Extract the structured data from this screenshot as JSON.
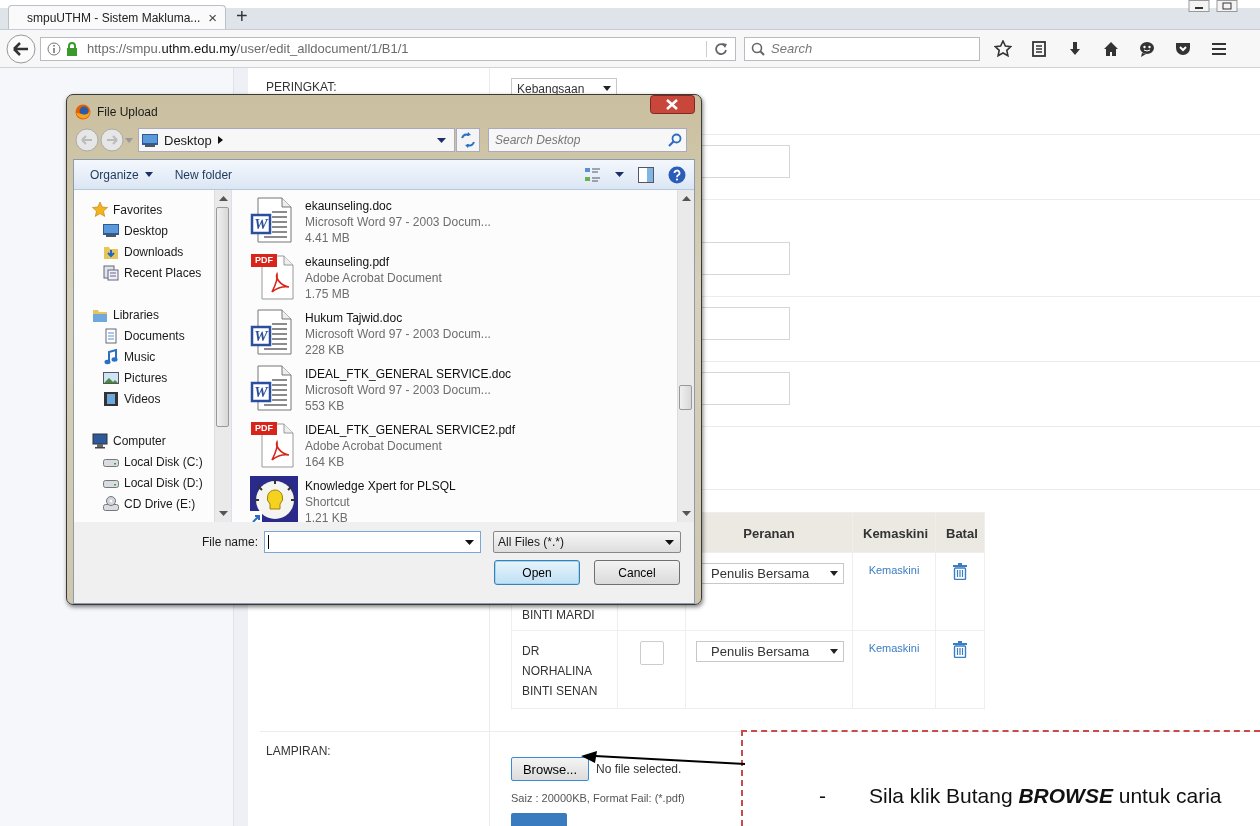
{
  "browser": {
    "tab": {
      "title": "smpuUTHM - Sistem Makluma...",
      "close": "×"
    },
    "new_tab": "+",
    "url": {
      "scheme": "https://smpu.",
      "host": "uthm.edu.my",
      "path": "/user/edit_alldocument/1/B1/1"
    },
    "search": {
      "placeholder": "Search"
    }
  },
  "form": {
    "rows": [
      {
        "kind": "select",
        "label": "PERINGKAT:",
        "value": "Kebangsaan"
      },
      {
        "kind": "input"
      },
      {
        "kind": "input"
      },
      {
        "kind": "input"
      },
      {
        "kind": "input"
      }
    ]
  },
  "authors_table": {
    "columns": [
      "Peranan",
      "Kemaskini",
      "Batal"
    ],
    "rows": [
      {
        "name": "BINTI MARDI",
        "role": "Penulis Bersama",
        "action": "Kemaskini"
      },
      {
        "name": "DR NORHALINA BINTI SENAN",
        "checked": false,
        "role": "Penulis Bersama",
        "action": "Kemaskini"
      }
    ]
  },
  "attachment": {
    "label": "LAMPIRAN:",
    "button": "Browse...",
    "status": "No file selected.",
    "hint": "Saiz : 20000KB, Format Fail: (*.pdf)"
  },
  "annotation": {
    "bullet": "-",
    "text": "Sila klik Butang **BROWSE** untuk caria"
  },
  "dialog": {
    "title": "File Upload",
    "location": "Desktop",
    "search": {
      "placeholder": "Search Desktop"
    },
    "toolbar": {
      "organize": "Organize",
      "new_folder": "New folder"
    },
    "nav": [
      {
        "label": "Favorites",
        "kind": "star",
        "children": [
          {
            "label": "Desktop",
            "kind": "desktop"
          },
          {
            "label": "Downloads",
            "kind": "downloads"
          },
          {
            "label": "Recent Places",
            "kind": "recent"
          }
        ]
      },
      {
        "label": "Libraries",
        "kind": "library",
        "children": [
          {
            "label": "Documents",
            "kind": "documents"
          },
          {
            "label": "Music",
            "kind": "music"
          },
          {
            "label": "Pictures",
            "kind": "pictures"
          },
          {
            "label": "Videos",
            "kind": "videos"
          }
        ]
      },
      {
        "label": "Computer",
        "kind": "computer",
        "children": [
          {
            "label": "Local Disk (C:)",
            "kind": "disk"
          },
          {
            "label": "Local Disk (D:)",
            "kind": "disk"
          },
          {
            "label": "CD Drive (E:)",
            "kind": "cd"
          }
        ]
      }
    ],
    "files": [
      {
        "kind": "word",
        "badge": "W",
        "name": "ekaunseling.doc",
        "type": "Microsoft Word 97 - 2003 Docum...",
        "size": "4.41 MB"
      },
      {
        "kind": "pdf",
        "badge": "PDF",
        "name": "ekaunseling.pdf",
        "type": "Adobe Acrobat Document",
        "size": "1.75 MB"
      },
      {
        "kind": "word",
        "badge": "W",
        "name": "Hukum Tajwid.doc",
        "type": "Microsoft Word 97 - 2003 Docum...",
        "size": "228 KB"
      },
      {
        "kind": "word",
        "badge": "W",
        "name": "IDEAL_FTK_GENERAL SERVICE.doc",
        "type": "Microsoft Word 97 - 2003 Docum...",
        "size": "553 KB"
      },
      {
        "kind": "pdf",
        "badge": "PDF",
        "name": "IDEAL_FTK_GENERAL SERVICE2.pdf",
        "type": "Adobe Acrobat Document",
        "size": "164 KB"
      },
      {
        "kind": "shortcut",
        "name": "Knowledge Xpert for PLSQL",
        "type": "Shortcut",
        "size": "1.21 KB"
      }
    ],
    "file_name": {
      "label": "File name:"
    },
    "filter": "All Files (*.*)",
    "buttons": [
      {
        "label": "Open",
        "default": true
      },
      {
        "label": "Cancel",
        "default": false
      }
    ]
  }
}
